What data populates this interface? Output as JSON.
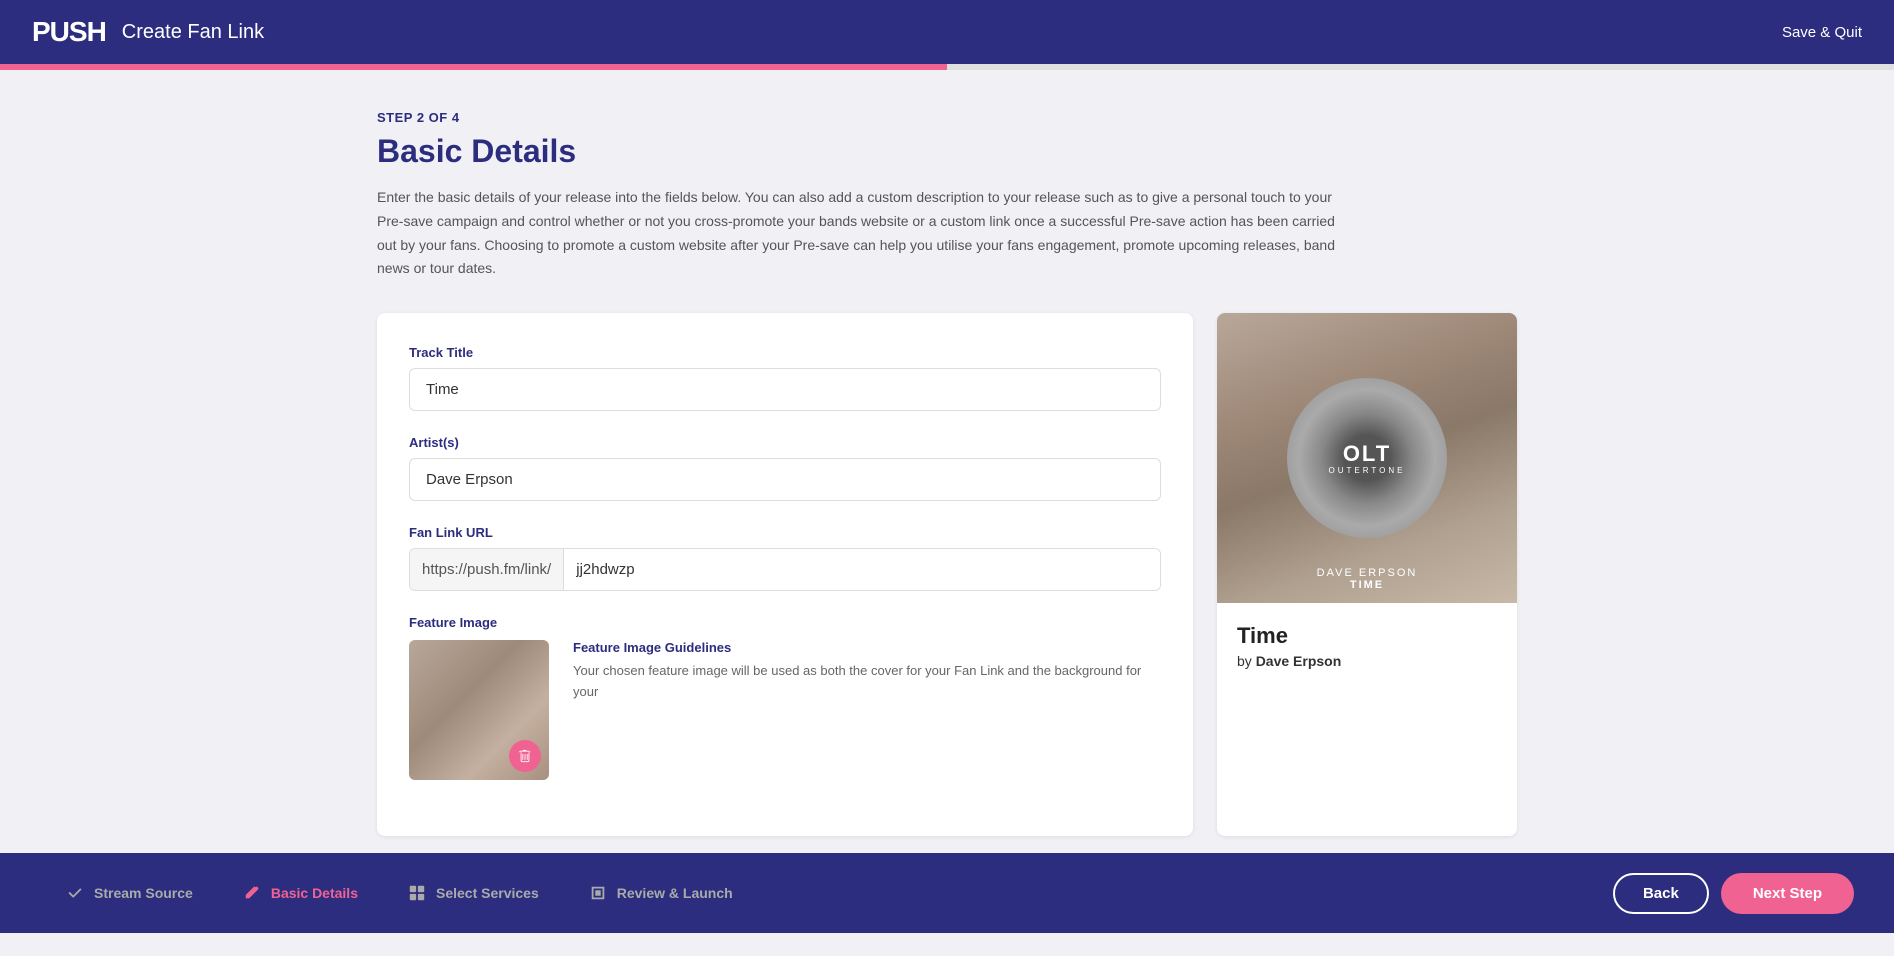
{
  "header": {
    "logo": "PUSH",
    "title": "Create Fan Link",
    "save_quit_label": "Save & Quit"
  },
  "progress": {
    "percent": 50,
    "step_label": "STEP 2 OF 4"
  },
  "page": {
    "title": "Basic Details",
    "description": "Enter the basic details of your release into the fields below. You can also add a custom description to your release such as to give a personal touch to your Pre-save campaign and control whether or not you cross-promote your bands website or a custom link once a successful Pre-save action has been carried out by your fans. Choosing to promote a custom website after your Pre-save can help you utilise your fans engagement, promote upcoming releases, band news or tour dates."
  },
  "form": {
    "track_title_label": "Track Title",
    "track_title_value": "Time",
    "artists_label": "Artist(s)",
    "artists_value": "Dave Erpson",
    "fan_link_url_label": "Fan Link URL",
    "fan_link_prefix": "https://push.fm/link/",
    "fan_link_suffix": "jj2hdwzp",
    "feature_image_label": "Feature Image",
    "image_guidelines_title": "Feature Image Guidelines",
    "image_guidelines_text": "Your chosen feature image will be used as both the cover for your Fan Link and the background for your"
  },
  "preview": {
    "track_title": "Time",
    "artist_prefix": "by",
    "artist_name": "Dave Erpson",
    "album_label_line1": "DAVE ERPSON",
    "album_label_line2": "TIME",
    "logo_text": "OLT",
    "logo_sub": "OUTERTONE"
  },
  "footer": {
    "steps": [
      {
        "id": "stream-source",
        "label": "Stream Source",
        "state": "completed"
      },
      {
        "id": "basic-details",
        "label": "Basic Details",
        "state": "active"
      },
      {
        "id": "select-services",
        "label": "Select Services",
        "state": "inactive"
      },
      {
        "id": "review-launch",
        "label": "Review & Launch",
        "state": "inactive"
      }
    ],
    "back_label": "Back",
    "next_label": "Next Step"
  }
}
